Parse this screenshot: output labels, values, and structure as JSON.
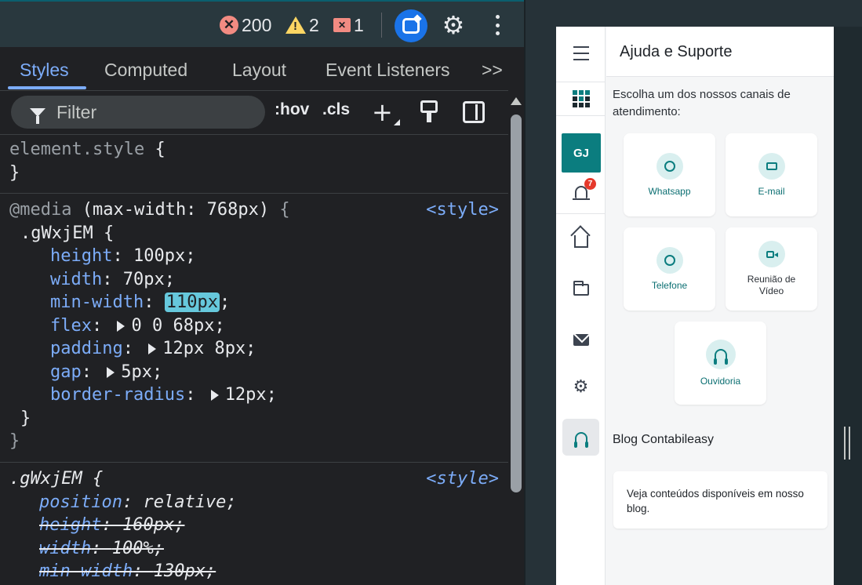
{
  "devtools": {
    "topbar": {
      "errors_count": "200",
      "warnings_count": "2",
      "issues_count": "1"
    },
    "tabs": [
      "Styles",
      "Computed",
      "Layout",
      "Event Listeners",
      ">>"
    ],
    "active_tab": "Styles",
    "toolbar": {
      "filter_placeholder": "Filter",
      "hov_label": ":hov",
      "cls_label": ".cls",
      "new_rule_label": "+"
    },
    "styles": {
      "element_style": {
        "selector": "element.style",
        "open": "{",
        "close": "}"
      },
      "media_rule": {
        "at": "@media",
        "query": "(max-width: 768px)",
        "open": "{",
        "source": "<style>",
        "selector": ".gWxjEM",
        "inner_open": "{",
        "inner_close": "}",
        "close": "}",
        "declarations": [
          {
            "prop": "height",
            "value": "100px;"
          },
          {
            "prop": "width",
            "value": "70px;"
          },
          {
            "prop": "min-width",
            "value": "110px",
            "highlighted": true
          },
          {
            "prop": "flex",
            "value": "0 0 68px;",
            "expandable": true
          },
          {
            "prop": "padding",
            "value": "12px 8px;",
            "expandable": true
          },
          {
            "prop": "gap",
            "value": "5px;",
            "expandable": true
          },
          {
            "prop": "border-radius",
            "value": "12px;",
            "expandable": true
          }
        ]
      },
      "class_rule": {
        "selector": ".gWxjEM",
        "open": "{",
        "source": "<style>",
        "declarations": [
          {
            "prop": "position",
            "value": "relative;",
            "overridden": false
          },
          {
            "prop": "height",
            "value": "160px;",
            "overridden": true
          },
          {
            "prop": "width",
            "value": "100%;",
            "overridden": true
          },
          {
            "prop": "min-width",
            "value": "130px;",
            "overridden": true
          }
        ]
      }
    }
  },
  "app": {
    "header_title": "Ajuda e Suporte",
    "avatar_initials": "GJ",
    "notification_count": "7",
    "intro": "Escolha um dos nossos canais de atendimento:",
    "channels": [
      {
        "label": "Whatsapp",
        "icon": "whatsapp-icon"
      },
      {
        "label": "E-mail",
        "icon": "email-icon"
      },
      {
        "label": "Telefone",
        "icon": "phone-icon"
      },
      {
        "label": "Reunião de Vídeo",
        "icon": "video-icon"
      },
      {
        "label": "Ouvidoria",
        "icon": "headset-icon"
      }
    ],
    "blog_title": "Blog Contabileasy",
    "blog_text": "Veja conteúdos disponíveis em nosso blog."
  },
  "colors": {
    "devtools_bg": "#202124",
    "devtools_accent": "#7cacf8",
    "highlight": "#66c8dc",
    "app_brand": "#0b7d7f",
    "error": "#f28b82",
    "warning": "#fdd663"
  }
}
